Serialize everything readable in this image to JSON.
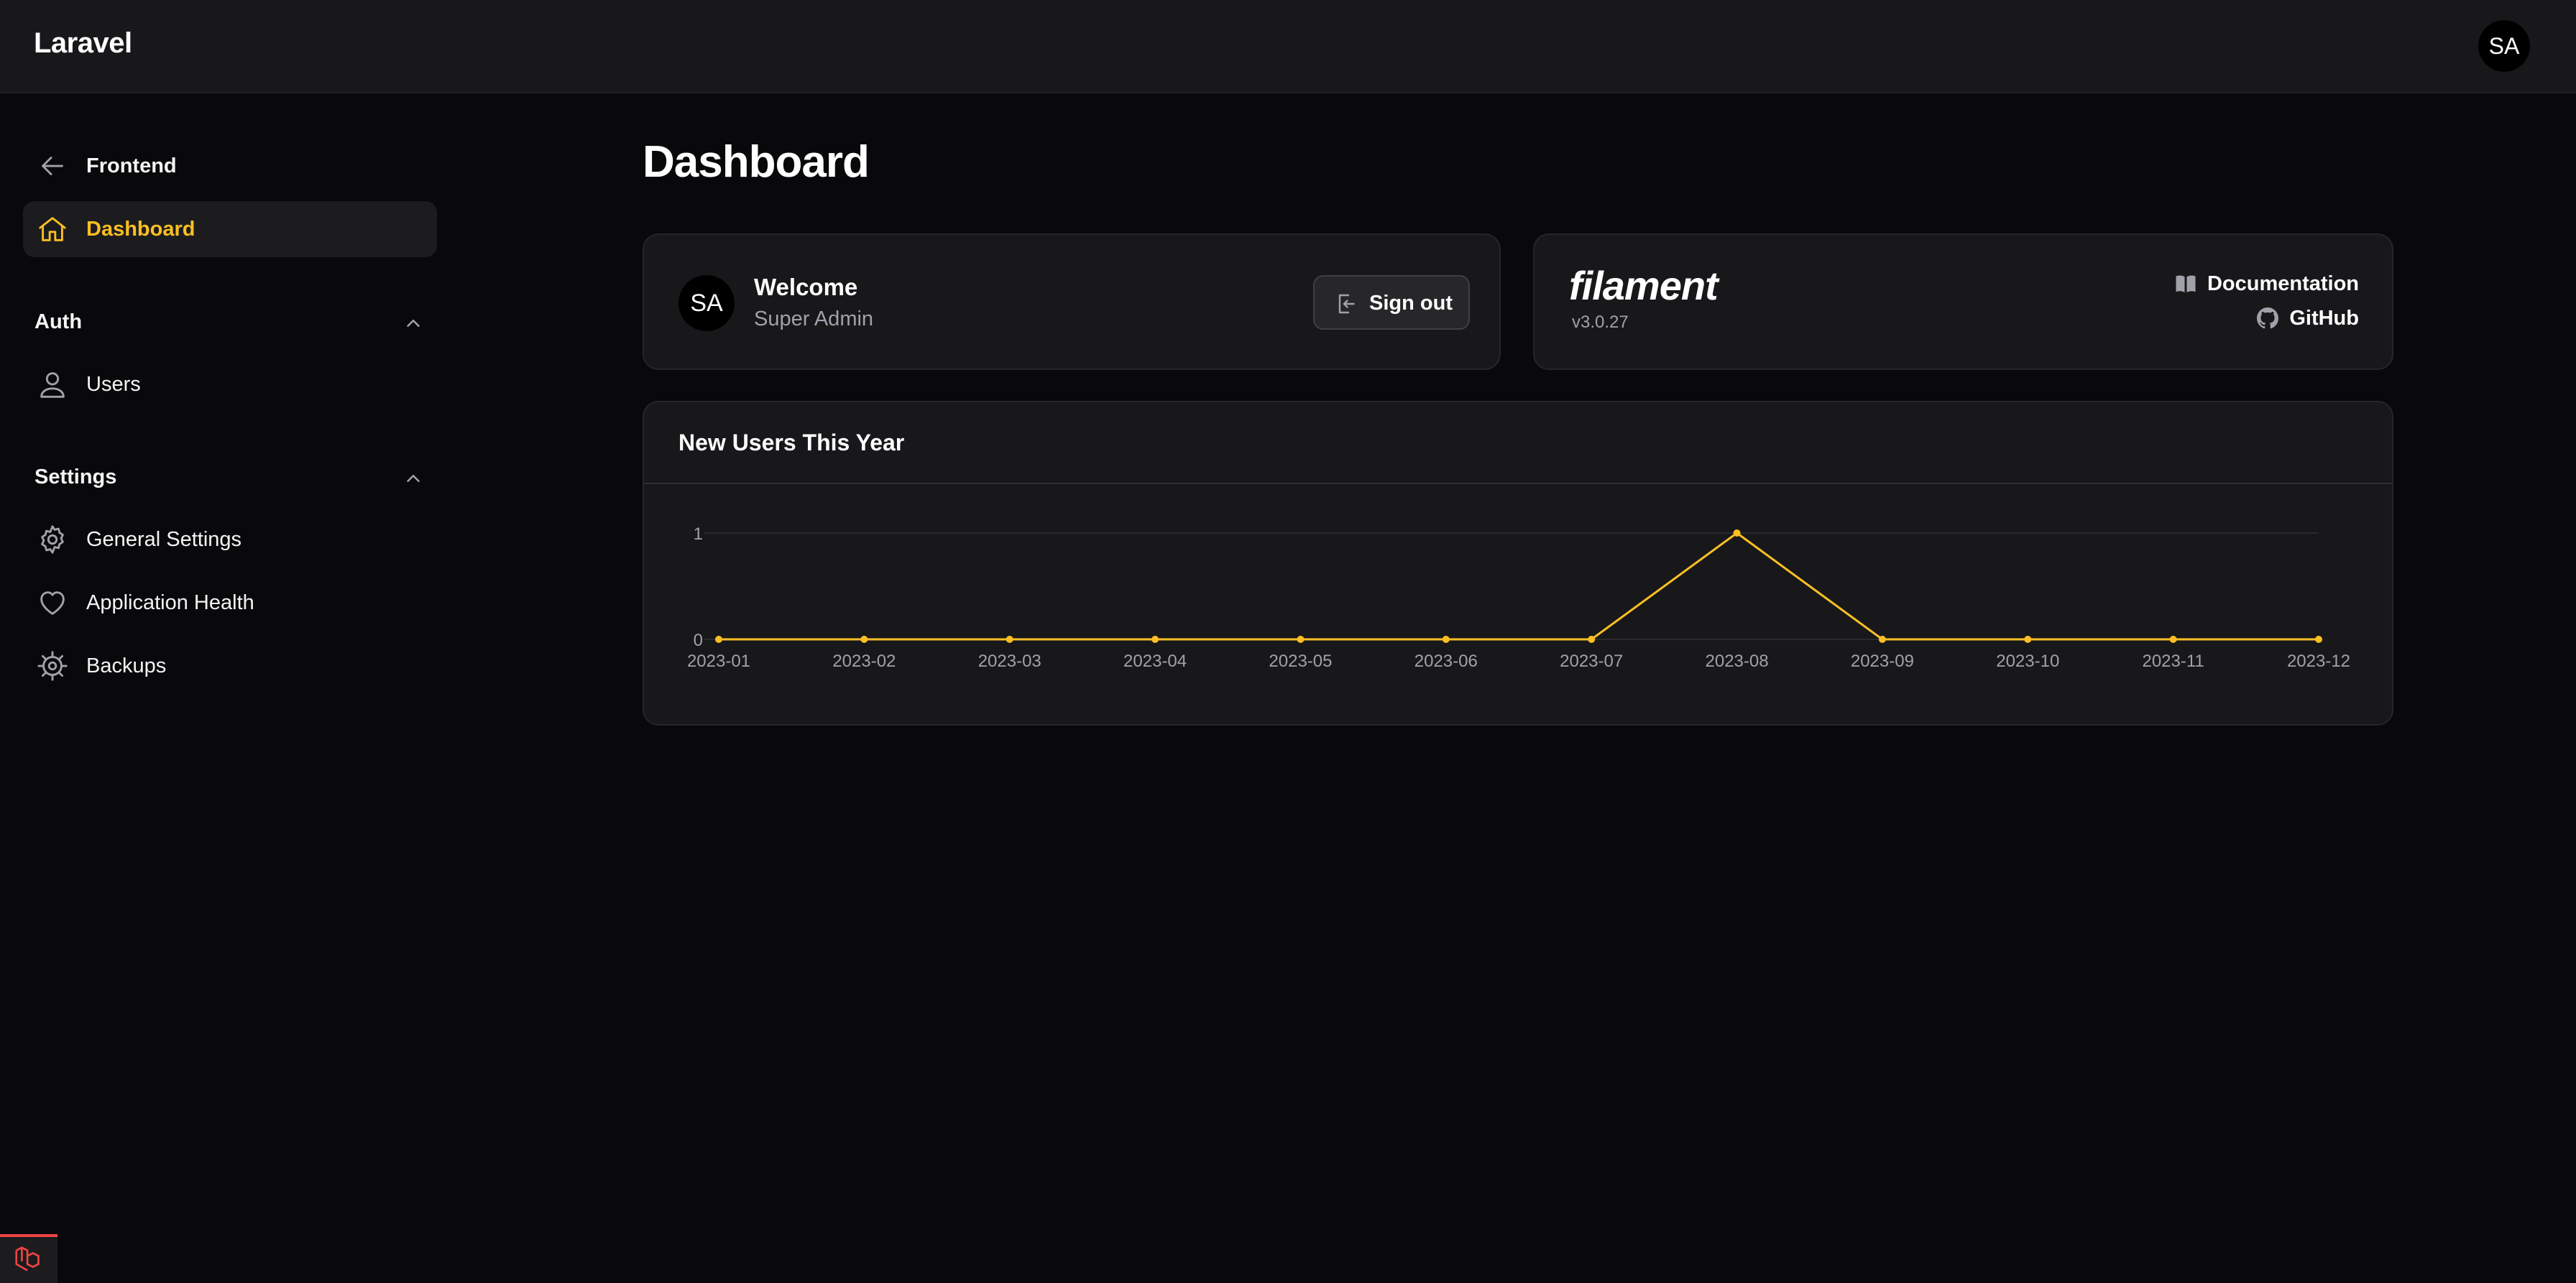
{
  "app": {
    "brand": "Laravel",
    "user_initials": "SA"
  },
  "sidebar": {
    "frontend_label": "Frontend",
    "dashboard_label": "Dashboard",
    "groups": [
      {
        "label": "Auth",
        "items": [
          {
            "label": "Users",
            "icon": "user-icon"
          }
        ]
      },
      {
        "label": "Settings",
        "items": [
          {
            "label": "General Settings",
            "icon": "gear-icon"
          },
          {
            "label": "Application Health",
            "icon": "heart-icon"
          },
          {
            "label": "Backups",
            "icon": "cog-wheel-icon"
          }
        ]
      }
    ]
  },
  "main": {
    "title": "Dashboard",
    "welcome": {
      "initials": "SA",
      "title": "Welcome",
      "subtitle": "Super Admin",
      "signout_label": "Sign out"
    },
    "filament": {
      "logo": "filament",
      "version": "v3.0.27",
      "documentation_label": "Documentation",
      "github_label": "GitHub"
    },
    "chart": {
      "title": "New Users This Year"
    }
  },
  "colors": {
    "accent": "#fbbf24",
    "background": "#09090b",
    "card": "#18181b"
  },
  "chart_data": {
    "type": "line",
    "title": "New Users This Year",
    "categories": [
      "2023-01",
      "2023-02",
      "2023-03",
      "2023-04",
      "2023-05",
      "2023-06",
      "2023-07",
      "2023-08",
      "2023-09",
      "2023-10",
      "2023-11",
      "2023-12"
    ],
    "series": [
      {
        "values": [
          0,
          0,
          0,
          0,
          0,
          0,
          0,
          1,
          0,
          0,
          0,
          0
        ]
      }
    ],
    "yticks": [
      "0",
      "1"
    ],
    "ylim": [
      0,
      1
    ],
    "grid": true,
    "color": "#fbbf24"
  }
}
